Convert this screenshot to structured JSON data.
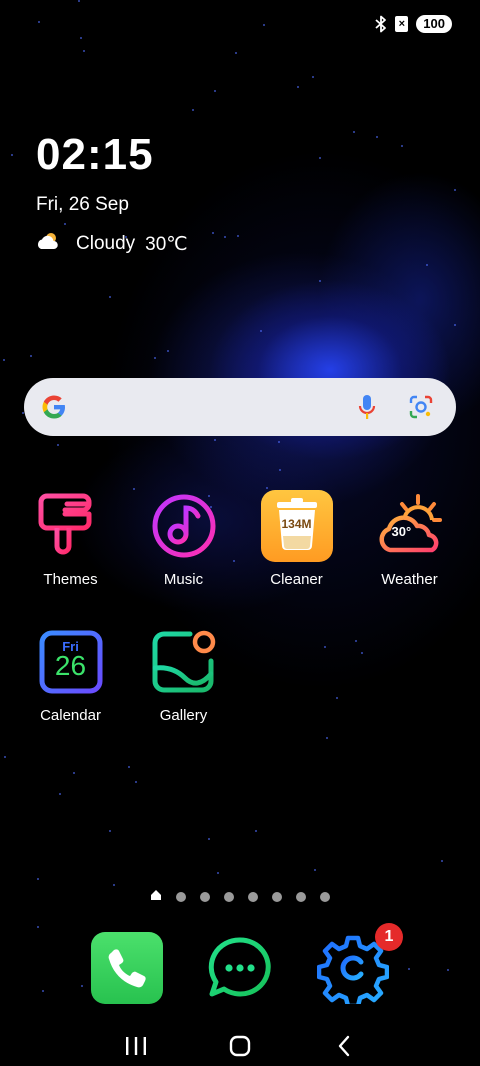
{
  "status_bar": {
    "battery": "100",
    "icons": [
      "bluetooth-icon",
      "no-sim-icon"
    ]
  },
  "clock_widget": {
    "time": "02:15",
    "date": "Fri, 26 Sep",
    "weather_condition": "Cloudy",
    "temperature": "30℃"
  },
  "search_bar": {
    "icons": [
      "google-g-icon",
      "microphone-icon",
      "lens-icon"
    ]
  },
  "apps": [
    {
      "label": "Themes",
      "icon": "themes-icon"
    },
    {
      "label": "Music",
      "icon": "music-icon"
    },
    {
      "label": "Cleaner",
      "icon": "cleaner-icon",
      "icon_text": "134M"
    },
    {
      "label": "Weather",
      "icon": "weather-icon",
      "icon_text": "30°"
    },
    {
      "label": "Calendar",
      "icon": "calendar-icon",
      "icon_day": "Fri",
      "icon_date": "26"
    },
    {
      "label": "Gallery",
      "icon": "gallery-icon"
    }
  ],
  "page_indicator": {
    "pages": 8,
    "current": 1
  },
  "dock": [
    {
      "icon": "phone-icon"
    },
    {
      "icon": "messages-icon"
    },
    {
      "icon": "settings-icon",
      "badge": "1"
    }
  ],
  "colors": {
    "phone_green": "#3ad45f",
    "badge_red": "#e52a2a",
    "search_bg": "#e9eaf0"
  }
}
